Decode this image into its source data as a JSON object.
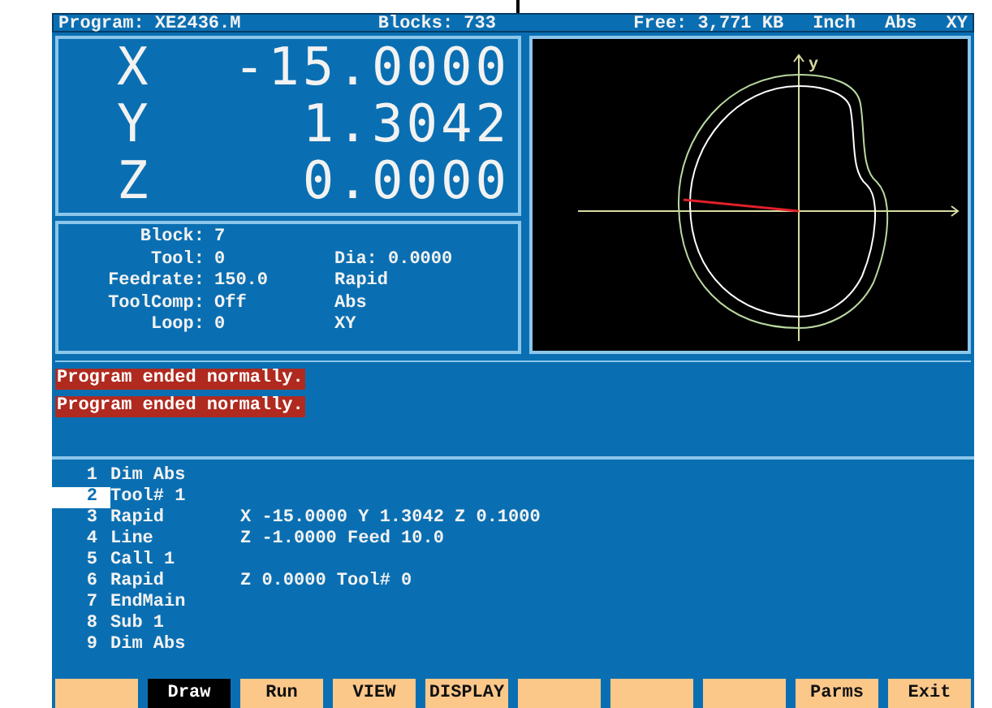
{
  "status_bar": {
    "program": "Program: XE2436.M",
    "blocks": "Blocks: 733",
    "free": "Free: 3,771 KB",
    "units": "Inch",
    "mode": "Abs",
    "plane": "XY"
  },
  "position": [
    {
      "axis": "X",
      "value": "-15.0000"
    },
    {
      "axis": "Y",
      "value": "1.3042"
    },
    {
      "axis": "Z",
      "value": "0.0000"
    }
  ],
  "info": [
    {
      "label": "Block:",
      "value": "7"
    },
    {
      "label": "Tool:",
      "value": "0",
      "extra": "Dia: 0.0000"
    },
    {
      "label": "Feedrate:",
      "value": "150.0",
      "extra": "Rapid"
    },
    {
      "label": "ToolComp:",
      "value": "Off",
      "extra": "Abs"
    },
    {
      "label": "Loop:",
      "value": "0",
      "extra": "XY"
    }
  ],
  "graphic": {
    "y_axis_label": "y"
  },
  "messages": [
    "Program ended normally.",
    "Program ended normally."
  ],
  "listing": [
    {
      "number": "1",
      "command": "Dim Abs",
      "selected": false
    },
    {
      "number": "2",
      "command": "Tool# 1",
      "selected": true
    },
    {
      "number": "3",
      "command": "Rapid",
      "args": "X -15.0000 Y 1.3042 Z 0.1000",
      "selected": false
    },
    {
      "number": "4",
      "command": "Line",
      "args": "Z -1.0000 Feed 10.0",
      "selected": false
    },
    {
      "number": "5",
      "command": "Call 1",
      "selected": false
    },
    {
      "number": "6",
      "command": "Rapid",
      "args": "Z 0.0000 Tool# 0",
      "selected": false
    },
    {
      "number": "7",
      "command": "EndMain",
      "selected": false
    },
    {
      "number": "8",
      "command": "Sub 1",
      "selected": false
    },
    {
      "number": "9",
      "command": "Dim Abs",
      "selected": false
    }
  ],
  "function_keys": [
    {
      "selected": false
    },
    {
      "label": "Draw",
      "selected": true
    },
    {
      "label": "Run",
      "selected": false
    },
    {
      "label": "VIEW",
      "selected": false
    },
    {
      "label": "DISPLAY",
      "selected": false
    },
    {
      "selected": false
    },
    {
      "selected": false
    },
    {
      "selected": false
    },
    {
      "label": "Parms",
      "selected": false
    },
    {
      "label": "Exit",
      "selected": false
    }
  ]
}
